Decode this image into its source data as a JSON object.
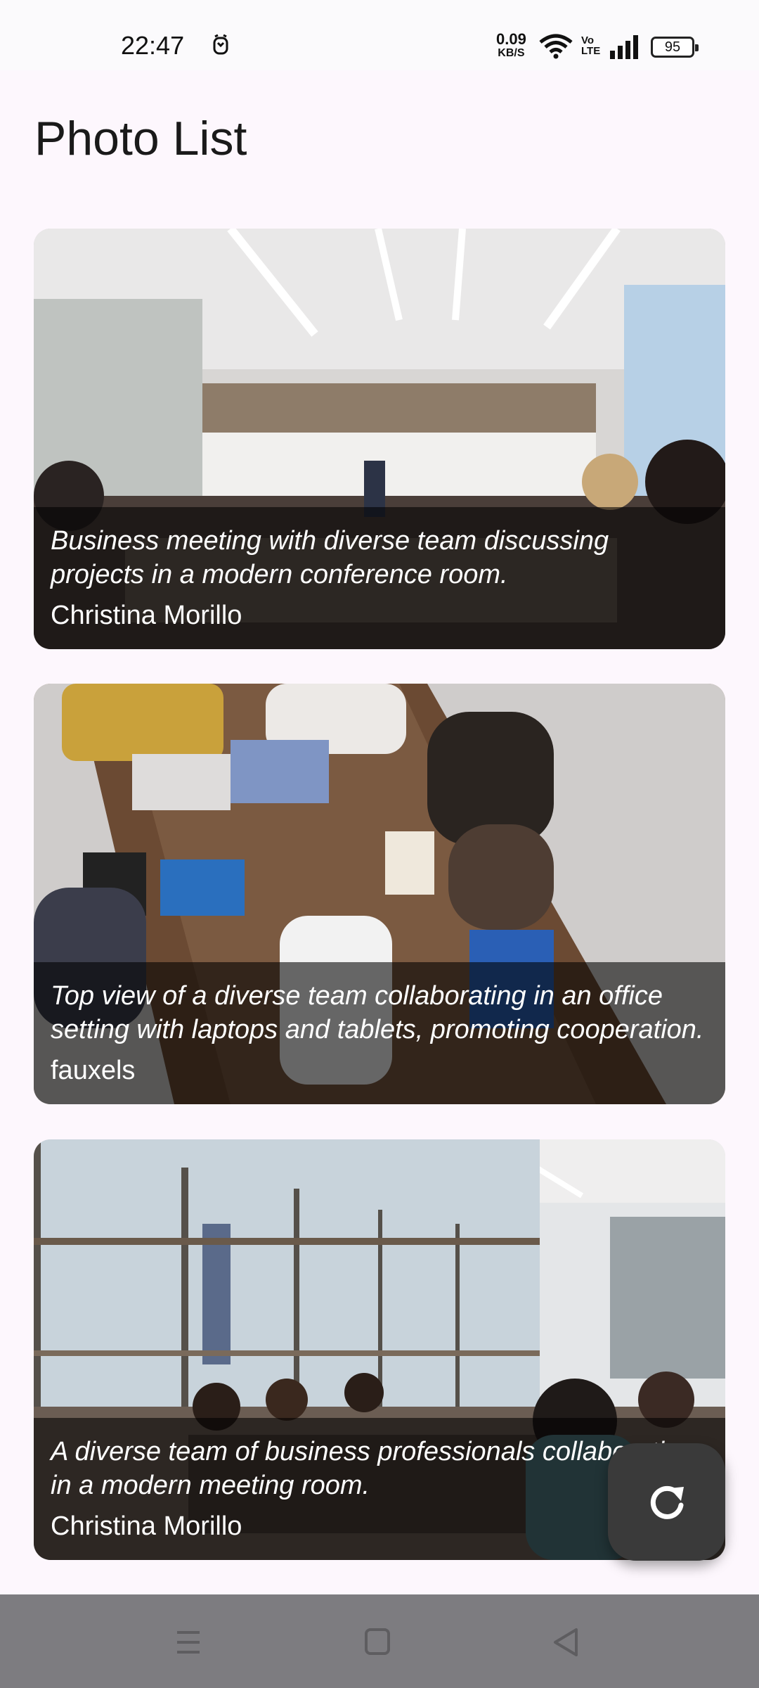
{
  "status_bar": {
    "time": "22:47",
    "net_speed_value": "0.09",
    "net_speed_unit": "KB/S",
    "volte": "Vo LTE",
    "battery": "95"
  },
  "app": {
    "title": "Photo List"
  },
  "photos": [
    {
      "description": "Business meeting with diverse team discussing projects in a modern conference room.",
      "author": "Christina Morillo"
    },
    {
      "description": "Top view of a diverse team collaborating in an office setting with laptops and tablets, promoting cooperation.",
      "author": "fauxels"
    },
    {
      "description": "A diverse team of business professionals collaborating in a modern meeting room.",
      "author": "Christina Morillo"
    }
  ],
  "fab": {
    "icon": "refresh-icon"
  },
  "nav": {
    "icons": [
      "menu-icon",
      "home-square-icon",
      "back-triangle-icon"
    ]
  }
}
